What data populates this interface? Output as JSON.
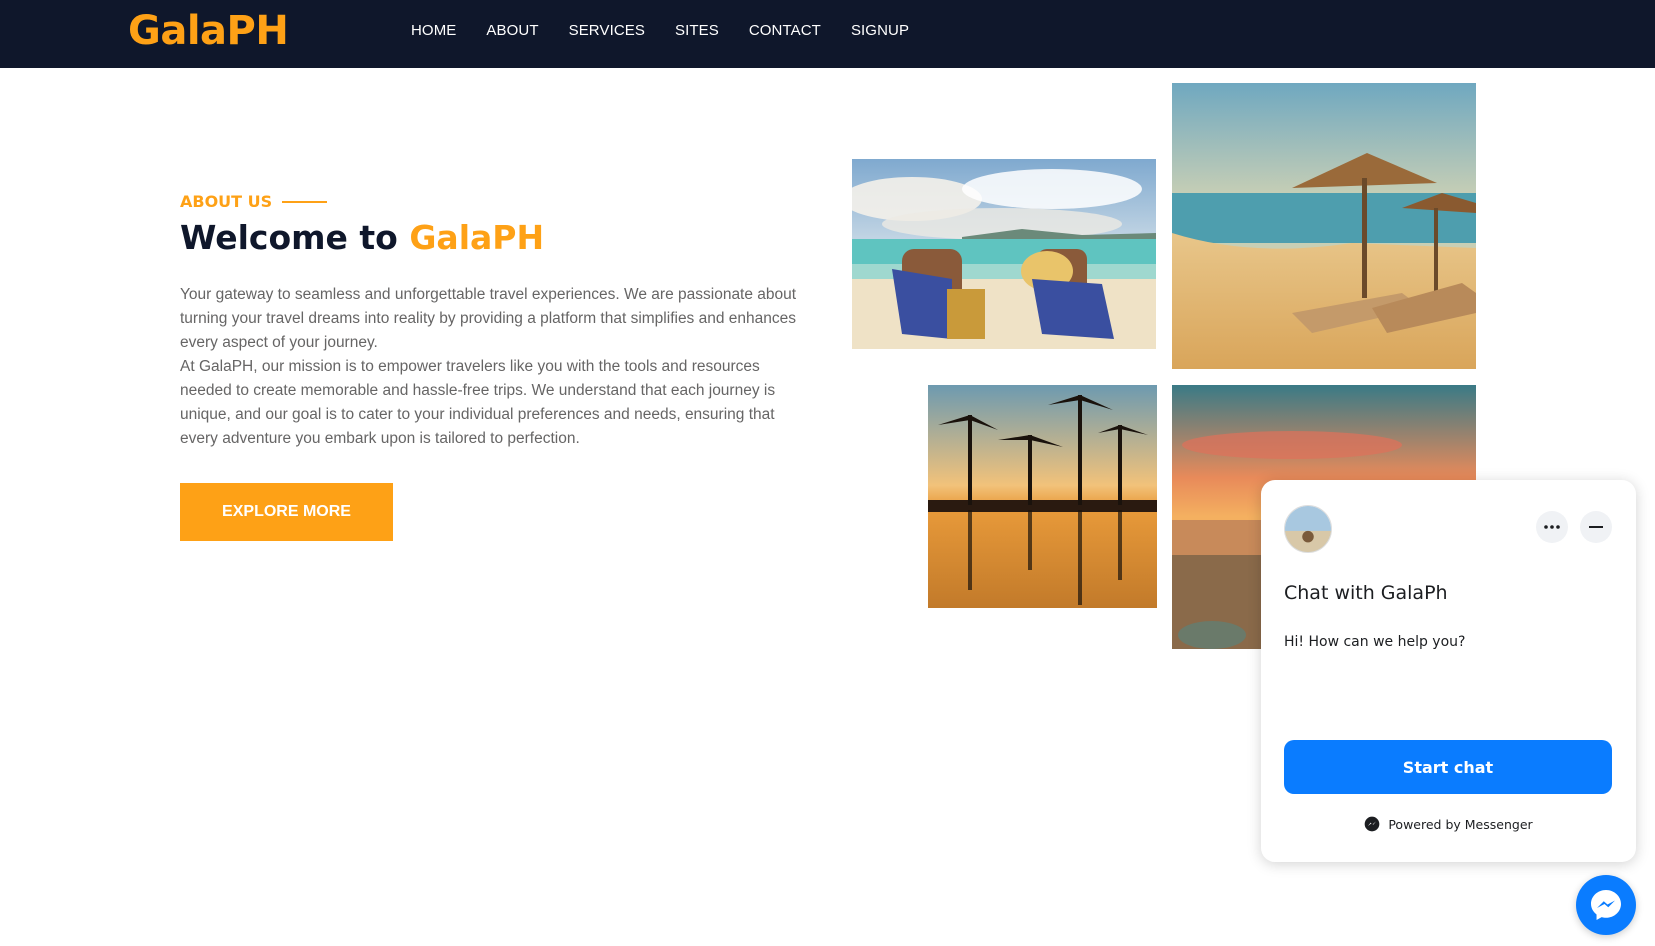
{
  "navbar": {
    "logo": "GalaPH",
    "links": [
      "HOME",
      "ABOUT",
      "SERVICES",
      "SITES",
      "CONTACT",
      "SIGNUP"
    ]
  },
  "about": {
    "label": "ABOUT US",
    "welcome_prefix": "Welcome to ",
    "welcome_brand": "GalaPH",
    "paragraph1": "Your gateway to seamless and unforgettable travel experiences. We are passionate about turning your travel dreams into reality by providing a platform that simplifies and enhances every aspect of your journey.",
    "paragraph2": "At GalaPH, our mission is to empower travelers like you with the tools and resources needed to create memorable and hassle-free trips. We understand that each journey is unique, and our goal is to cater to your individual preferences and needs, ensuring that every adventure you embark upon is tailored to perfection.",
    "button": "EXPLORE MORE"
  },
  "chat": {
    "title": "Chat with GalaPh",
    "message": "Hi! How can we help you?",
    "start_button": "Start chat",
    "powered_by": "Powered by Messenger"
  },
  "colors": {
    "brand": "#fea116",
    "navbar": "#0f172b",
    "messenger_blue": "#0a7cff"
  }
}
